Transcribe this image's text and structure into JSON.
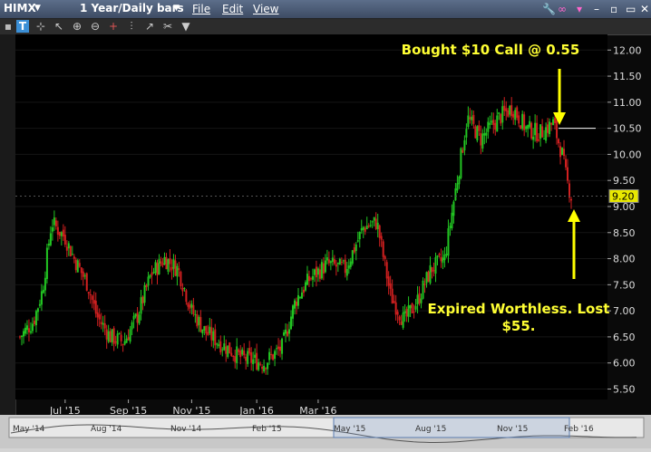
{
  "toolbar": {
    "symbol": "HIMX",
    "timeframe": "1 Year/Daily bars",
    "menus": [
      "File",
      "Edit",
      "View"
    ]
  },
  "annotations": {
    "buy": "Bought $10 Call @ 0.55",
    "expired_line1": "Expired Worthless. Lost",
    "expired_line2": "$55."
  },
  "price_label": "9.20",
  "chart_data": {
    "type": "candlestick",
    "symbol": "HIMX",
    "period": "1 Year/Daily bars",
    "x_tick_labels": [
      "Jul '15",
      "Sep '15",
      "Nov '15",
      "Jan '16",
      "Mar '16"
    ],
    "y_tick_labels": [
      "5.50",
      "6.00",
      "6.50",
      "7.00",
      "7.50",
      "8.00",
      "8.50",
      "9.00",
      "9.50",
      "10.00",
      "10.50",
      "11.00",
      "11.50",
      "12.00"
    ],
    "ylim": [
      5.3,
      12.3
    ],
    "last_price": 9.2,
    "trade_price_level": 10.5,
    "overview_labels": [
      "May '14",
      "Aug '14",
      "Nov '14",
      "Feb '15",
      "May '15",
      "Aug '15",
      "Nov '15",
      "Feb '16"
    ],
    "anchors": [
      [
        0,
        6.5
      ],
      [
        15,
        6.8
      ],
      [
        25,
        7.4
      ],
      [
        35,
        8.7
      ],
      [
        50,
        8.4
      ],
      [
        60,
        8.0
      ],
      [
        75,
        7.5
      ],
      [
        85,
        6.9
      ],
      [
        100,
        6.5
      ],
      [
        115,
        6.4
      ],
      [
        130,
        6.9
      ],
      [
        145,
        7.7
      ],
      [
        160,
        8.0
      ],
      [
        175,
        7.8
      ],
      [
        190,
        7.0
      ],
      [
        205,
        6.6
      ],
      [
        220,
        6.4
      ],
      [
        245,
        6.1
      ],
      [
        270,
        6.0
      ],
      [
        290,
        6.3
      ],
      [
        305,
        7.2
      ],
      [
        320,
        7.6
      ],
      [
        340,
        7.9
      ],
      [
        360,
        7.8
      ],
      [
        380,
        8.6
      ],
      [
        395,
        8.7
      ],
      [
        410,
        7.3
      ],
      [
        425,
        6.8
      ],
      [
        440,
        7.2
      ],
      [
        455,
        7.8
      ],
      [
        470,
        8.0
      ],
      [
        480,
        9.1
      ],
      [
        495,
        10.7
      ],
      [
        510,
        10.3
      ],
      [
        530,
        10.7
      ],
      [
        545,
        10.9
      ],
      [
        560,
        10.5
      ],
      [
        575,
        10.4
      ],
      [
        590,
        10.6
      ],
      [
        600,
        10.0
      ],
      [
        605,
        9.5
      ],
      [
        610,
        9.2
      ]
    ]
  }
}
